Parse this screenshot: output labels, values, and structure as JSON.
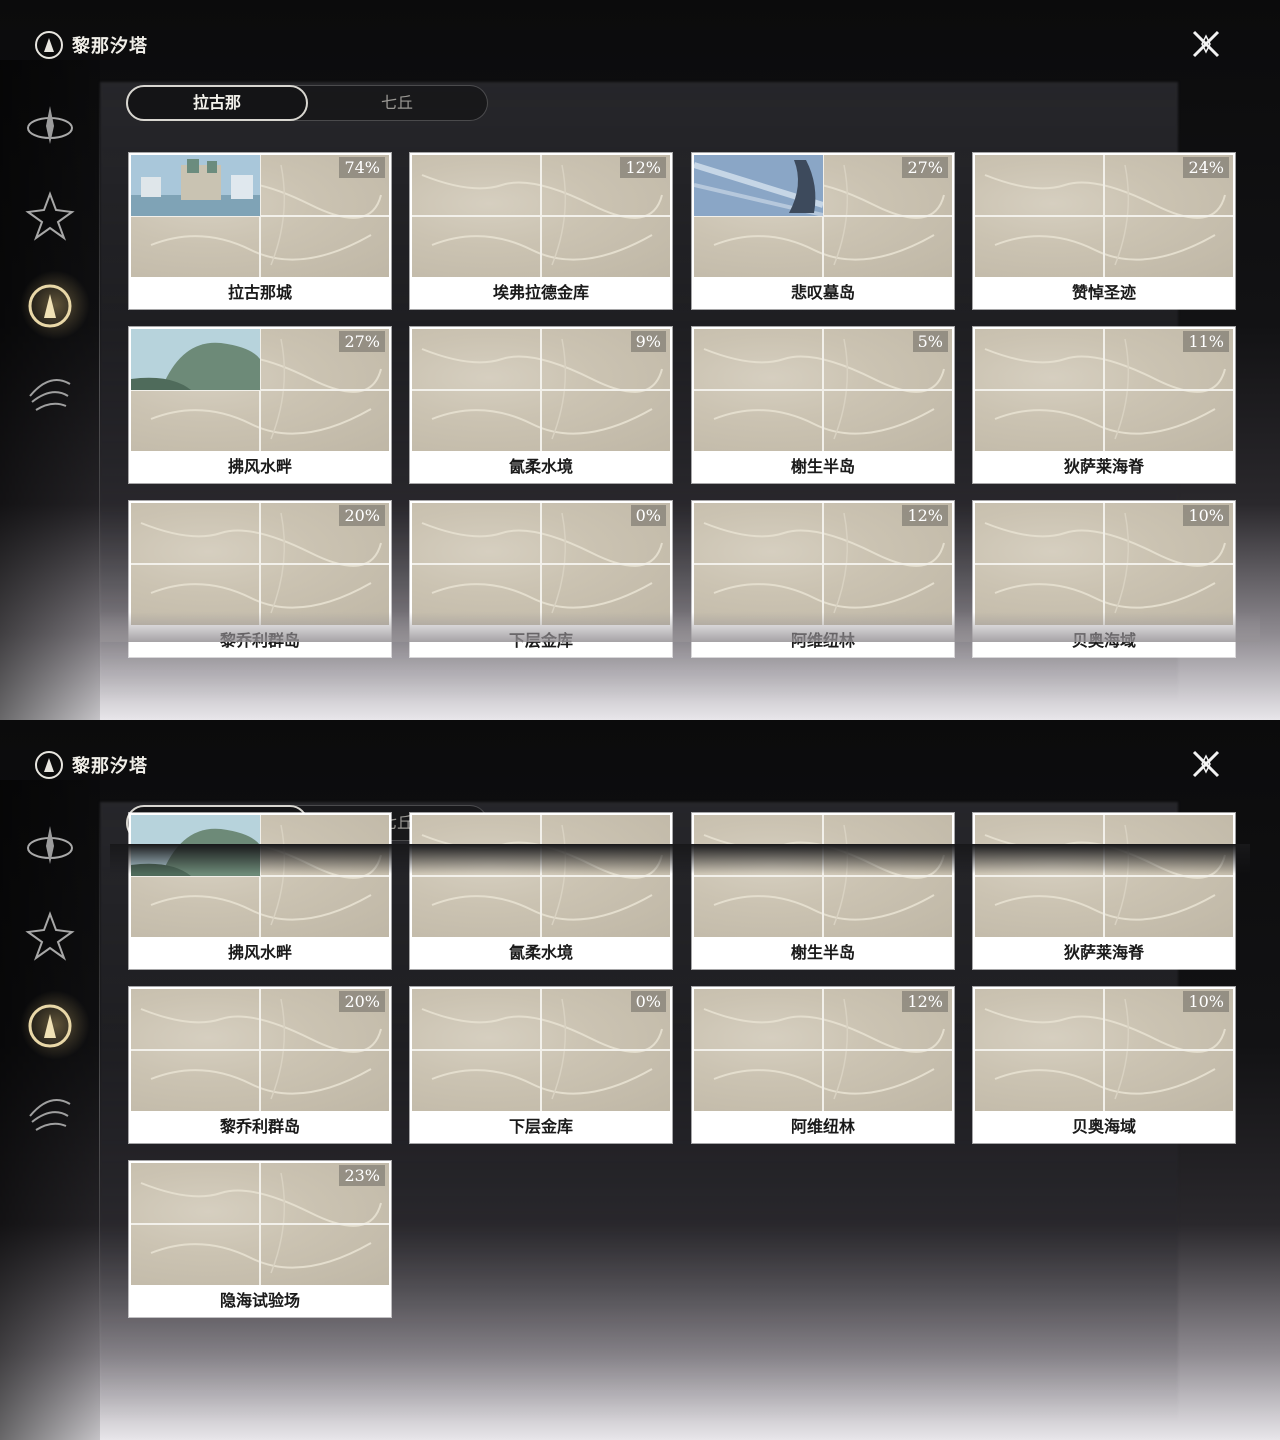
{
  "app": {
    "title": "黎那汐塔"
  },
  "tabs": [
    {
      "label": "拉古那",
      "active": true
    },
    {
      "label": "七丘",
      "active": false
    }
  ],
  "sidebar": {
    "items": [
      {
        "name": "sidebar-item-1",
        "icon": "emblem-icon"
      },
      {
        "name": "sidebar-item-2",
        "icon": "star-emblem-icon"
      },
      {
        "name": "sidebar-item-3",
        "icon": "region-crest-icon",
        "active": true
      },
      {
        "name": "sidebar-item-4",
        "icon": "wing-emblem-icon"
      }
    ]
  },
  "panel1": {
    "cards": [
      {
        "name": "拉古那城",
        "percent": "74%",
        "image": "city"
      },
      {
        "name": "埃弗拉德金库",
        "percent": "12%"
      },
      {
        "name": "悲叹墓岛",
        "percent": "27%",
        "image": "island"
      },
      {
        "name": "赞悼圣迹",
        "percent": "24%"
      },
      {
        "name": "拂风水畔",
        "percent": "27%",
        "image": "shore"
      },
      {
        "name": "氤柔水境",
        "percent": "9%"
      },
      {
        "name": "榭生半岛",
        "percent": "5%"
      },
      {
        "name": "狄萨莱海脊",
        "percent": "11%"
      },
      {
        "name": "黎乔利群岛",
        "percent": "20%"
      },
      {
        "name": "下层金库",
        "percent": "0%"
      },
      {
        "name": "阿维纽林",
        "percent": "12%"
      },
      {
        "name": "贝奥海域",
        "percent": "10%"
      }
    ]
  },
  "panel2": {
    "cards": [
      {
        "name": "拂风水畔",
        "image": "shore"
      },
      {
        "name": "氤柔水境"
      },
      {
        "name": "榭生半岛"
      },
      {
        "name": "狄萨莱海脊"
      },
      {
        "name": "黎乔利群岛",
        "percent": "20%"
      },
      {
        "name": "下层金库",
        "percent": "0%"
      },
      {
        "name": "阿维纽林",
        "percent": "12%"
      },
      {
        "name": "贝奥海域",
        "percent": "10%"
      },
      {
        "name": "隐海试验场",
        "percent": "23%"
      }
    ]
  },
  "colors": {
    "card_bg": "#ffffff",
    "map_tone": "#cbc3b2",
    "badge": "#8c877d",
    "active_glow": "#ffdc8c"
  }
}
